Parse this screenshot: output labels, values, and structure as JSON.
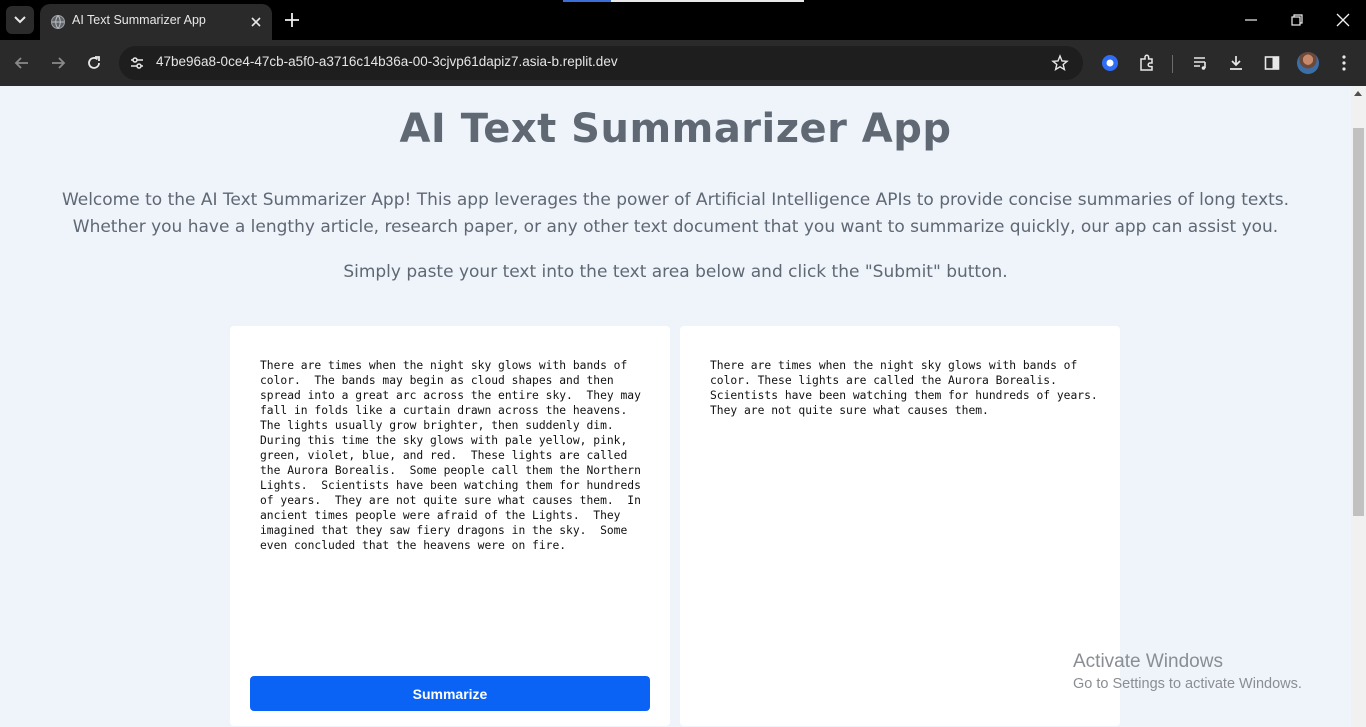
{
  "browser": {
    "tab_title": "AI Text Summarizer App",
    "url": "47be96a8-0ce4-47cb-a5f0-a3716c14b36a-00-3cjvp61dapiz7.asia-b.replit.dev"
  },
  "page": {
    "title": "AI Text Summarizer App",
    "intro": "Welcome to the AI Text Summarizer App! This app leverages the power of Artificial Intelligence APIs to provide concise summaries of long texts. Whether you have a lengthy article, research paper, or any other text document that you want to summarize quickly, our app can assist you.",
    "instruction": "Simply paste your text into the text area below and click the \"Submit\" button.",
    "input_text": "There are times when the night sky glows with bands of color.  The bands may begin as cloud shapes and then spread into a great arc across the entire sky.  They may fall in folds like a curtain drawn across the heavens.  The lights usually grow brighter, then suddenly dim.  During this time the sky glows with pale yellow, pink, green, violet, blue, and red.  These lights are called the Aurora Borealis.  Some people call them the Northern Lights.  Scientists have been watching them for hundreds of years.  They are not quite sure what causes them.  In ancient times people were afraid of the Lights.  They imagined that they saw fiery dragons in the sky.  Some even concluded that the heavens were on fire.",
    "summary_text": "There are times when the night sky glows with bands of color. These lights are called the Aurora Borealis. Scientists have been watching them for hundreds of years. They are not quite sure what causes them.",
    "summarize_label": "Summarize"
  },
  "watermark": {
    "line1": "Activate Windows",
    "line2": "Go to Settings to activate Windows."
  }
}
